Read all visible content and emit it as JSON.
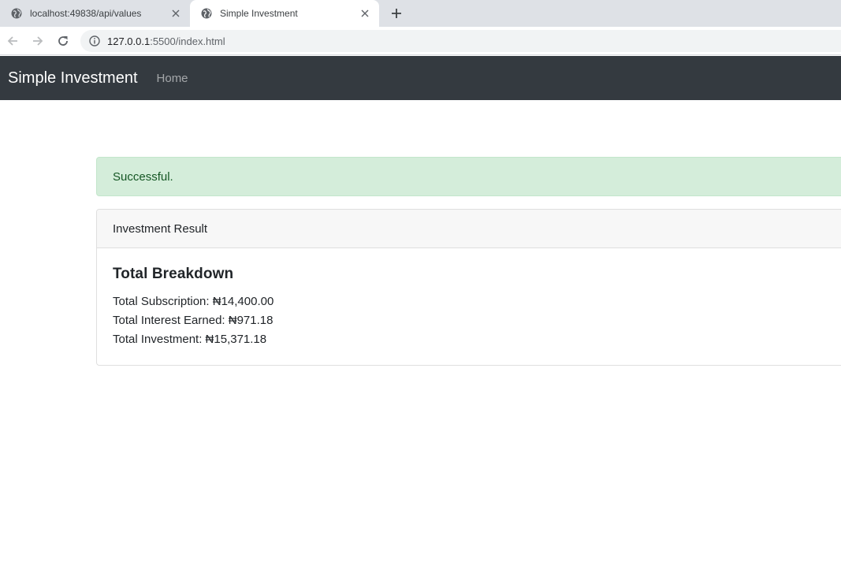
{
  "browser": {
    "tabs": [
      {
        "title": "localhost:49838/api/values",
        "active": false,
        "icon": "globe-icon"
      },
      {
        "title": "Simple Investment",
        "active": true,
        "icon": "globe-icon"
      }
    ],
    "url_host": "127.0.0.1",
    "url_path": ":5500/index.html"
  },
  "navbar": {
    "brand": "Simple Investment",
    "links": [
      "Home"
    ]
  },
  "alert": {
    "message": "Successful."
  },
  "card": {
    "header": "Investment Result",
    "title": "Total Breakdown",
    "lines": [
      "Total Subscription: ₦14,400.00",
      "Total Interest Earned: ₦971.18",
      "Total Investment: ₦15,371.18"
    ]
  },
  "colors": {
    "navbar_bg": "#343a40",
    "alert_bg": "#d4edda",
    "alert_text": "#155724",
    "card_header_bg": "#f7f7f7"
  }
}
